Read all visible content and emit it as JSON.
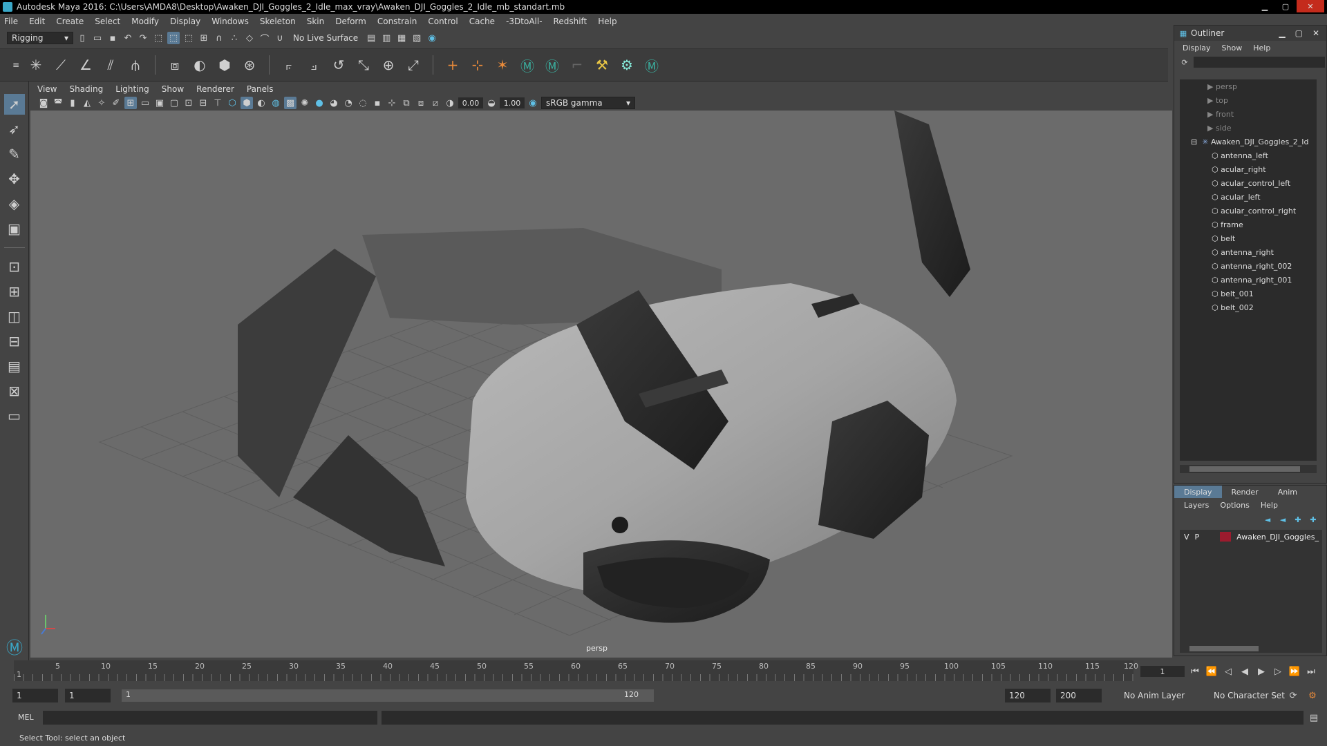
{
  "window": {
    "title": "Autodesk Maya 2016: C:\\Users\\AMDA8\\Desktop\\Awaken_DJI_Goggles_2_Idle_max_vray\\Awaken_DJI_Goggles_2_Idle_mb_standart.mb"
  },
  "menu": [
    "File",
    "Edit",
    "Create",
    "Select",
    "Modify",
    "Display",
    "Windows",
    "Skeleton",
    "Skin",
    "Deform",
    "Constrain",
    "Control",
    "Cache",
    "-3DtoAll-",
    "Redshift",
    "Help"
  ],
  "shelf": {
    "mode": "Rigging",
    "live_surface": "No Live Surface"
  },
  "panel": {
    "menu": [
      "View",
      "Shading",
      "Lighting",
      "Show",
      "Renderer",
      "Panels"
    ],
    "exposure": "0.00",
    "gamma": "1.00",
    "color_space": "sRGB gamma",
    "camera_label": "persp"
  },
  "outliner": {
    "title": "Outliner",
    "menu": [
      "Display",
      "Show",
      "Help"
    ],
    "cameras": [
      "persp",
      "top",
      "front",
      "side"
    ],
    "group": "Awaken_DJI_Goggles_2_Id",
    "children": [
      "antenna_left",
      "acular_right",
      "acular_control_left",
      "acular_left",
      "acular_control_right",
      "frame",
      "belt",
      "antenna_right",
      "antenna_right_002",
      "antenna_right_001",
      "belt_001",
      "belt_002"
    ]
  },
  "layers": {
    "tabs": [
      "Display",
      "Render",
      "Anim"
    ],
    "menu": [
      "Layers",
      "Options",
      "Help"
    ],
    "row": {
      "v": "V",
      "p": "P",
      "name": "Awaken_DJI_Goggles_",
      "color": "#9c1b2e"
    }
  },
  "timeline": {
    "ticks": [
      "1",
      "5",
      "10",
      "15",
      "20",
      "25",
      "30",
      "35",
      "40",
      "45",
      "50",
      "55",
      "60",
      "65",
      "70",
      "75",
      "80",
      "85",
      "90",
      "95",
      "100",
      "105",
      "110",
      "115",
      "120"
    ],
    "current_frame": "1"
  },
  "range": {
    "start": "1",
    "playback_start": "1",
    "slider_start": "1",
    "slider_end": "120",
    "playback_end": "120",
    "end": "200",
    "anim_layer": "No Anim Layer",
    "character_set": "No Character Set"
  },
  "command": {
    "mode": "MEL"
  },
  "help": {
    "text": "Select Tool: select an object"
  }
}
